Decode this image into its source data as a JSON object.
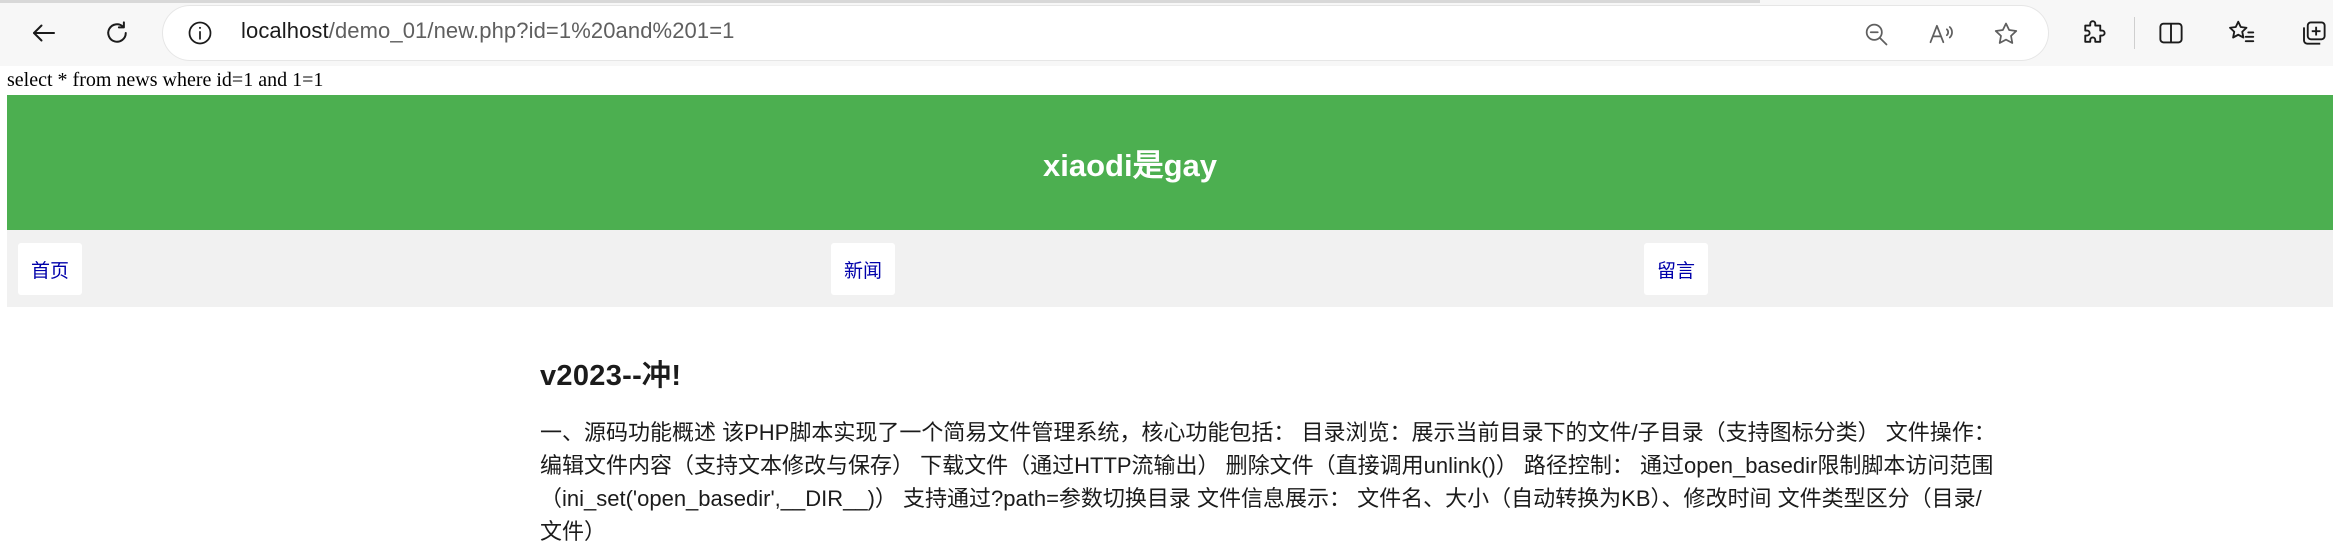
{
  "browser": {
    "url_host": "localhost",
    "url_path": "/demo_01/new.php?id=1%20and%201=1",
    "icons": {
      "back": "back-arrow-icon",
      "refresh": "refresh-icon",
      "info": "info-icon",
      "zoom_out": "zoom-out-icon",
      "read_aloud": "read-aloud-icon",
      "favorite": "star-icon",
      "extensions": "puzzle-icon",
      "split_screen": "split-screen-icon",
      "favorites": "favorites-list-icon",
      "collections": "collections-icon"
    }
  },
  "page": {
    "sql_query": "select * from news where id=1 and 1=1",
    "site_title": "xiaodi是gay",
    "nav": [
      {
        "label": "首页"
      },
      {
        "label": "新闻"
      },
      {
        "label": "留言"
      }
    ],
    "article": {
      "title": "v2023--冲!",
      "body": "一、源码功能概述 该PHP脚本实现了一个简易文件管理系统，核心功能包括： 目录浏览：展示当前目录下的文件/子目录（支持图标分类） 文件操作： 编辑文件内容（支持文本修改与保存） 下载文件（通过HTTP流输出） 删除文件（直接调用unlink()） 路径控制： 通过open_basedir限制脚本访问范围（ini_set('open_basedir',__DIR__)） 支持通过?path=参数切换目录 文件信息展示： 文件名、大小（自动转换为KB）、修改时间 文件类型区分（目录/文件）"
    }
  },
  "colors": {
    "header_bg": "#4caf50",
    "nav_bg": "#f1f1f1",
    "link": "#0000aa"
  }
}
